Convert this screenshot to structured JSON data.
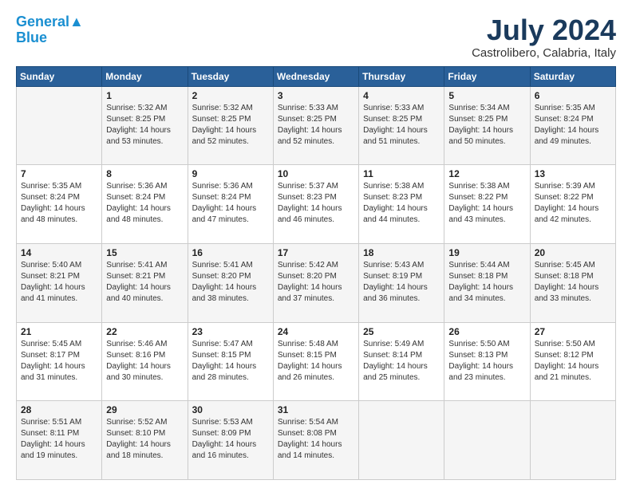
{
  "header": {
    "logo_line1": "General",
    "logo_line2": "Blue",
    "main_title": "July 2024",
    "subtitle": "Castrolibero, Calabria, Italy"
  },
  "calendar": {
    "days_of_week": [
      "Sunday",
      "Monday",
      "Tuesday",
      "Wednesday",
      "Thursday",
      "Friday",
      "Saturday"
    ],
    "weeks": [
      [
        {
          "day": "",
          "info": ""
        },
        {
          "day": "1",
          "info": "Sunrise: 5:32 AM\nSunset: 8:25 PM\nDaylight: 14 hours\nand 53 minutes."
        },
        {
          "day": "2",
          "info": "Sunrise: 5:32 AM\nSunset: 8:25 PM\nDaylight: 14 hours\nand 52 minutes."
        },
        {
          "day": "3",
          "info": "Sunrise: 5:33 AM\nSunset: 8:25 PM\nDaylight: 14 hours\nand 52 minutes."
        },
        {
          "day": "4",
          "info": "Sunrise: 5:33 AM\nSunset: 8:25 PM\nDaylight: 14 hours\nand 51 minutes."
        },
        {
          "day": "5",
          "info": "Sunrise: 5:34 AM\nSunset: 8:25 PM\nDaylight: 14 hours\nand 50 minutes."
        },
        {
          "day": "6",
          "info": "Sunrise: 5:35 AM\nSunset: 8:24 PM\nDaylight: 14 hours\nand 49 minutes."
        }
      ],
      [
        {
          "day": "7",
          "info": "Sunrise: 5:35 AM\nSunset: 8:24 PM\nDaylight: 14 hours\nand 48 minutes."
        },
        {
          "day": "8",
          "info": "Sunrise: 5:36 AM\nSunset: 8:24 PM\nDaylight: 14 hours\nand 48 minutes."
        },
        {
          "day": "9",
          "info": "Sunrise: 5:36 AM\nSunset: 8:24 PM\nDaylight: 14 hours\nand 47 minutes."
        },
        {
          "day": "10",
          "info": "Sunrise: 5:37 AM\nSunset: 8:23 PM\nDaylight: 14 hours\nand 46 minutes."
        },
        {
          "day": "11",
          "info": "Sunrise: 5:38 AM\nSunset: 8:23 PM\nDaylight: 14 hours\nand 44 minutes."
        },
        {
          "day": "12",
          "info": "Sunrise: 5:38 AM\nSunset: 8:22 PM\nDaylight: 14 hours\nand 43 minutes."
        },
        {
          "day": "13",
          "info": "Sunrise: 5:39 AM\nSunset: 8:22 PM\nDaylight: 14 hours\nand 42 minutes."
        }
      ],
      [
        {
          "day": "14",
          "info": "Sunrise: 5:40 AM\nSunset: 8:21 PM\nDaylight: 14 hours\nand 41 minutes."
        },
        {
          "day": "15",
          "info": "Sunrise: 5:41 AM\nSunset: 8:21 PM\nDaylight: 14 hours\nand 40 minutes."
        },
        {
          "day": "16",
          "info": "Sunrise: 5:41 AM\nSunset: 8:20 PM\nDaylight: 14 hours\nand 38 minutes."
        },
        {
          "day": "17",
          "info": "Sunrise: 5:42 AM\nSunset: 8:20 PM\nDaylight: 14 hours\nand 37 minutes."
        },
        {
          "day": "18",
          "info": "Sunrise: 5:43 AM\nSunset: 8:19 PM\nDaylight: 14 hours\nand 36 minutes."
        },
        {
          "day": "19",
          "info": "Sunrise: 5:44 AM\nSunset: 8:18 PM\nDaylight: 14 hours\nand 34 minutes."
        },
        {
          "day": "20",
          "info": "Sunrise: 5:45 AM\nSunset: 8:18 PM\nDaylight: 14 hours\nand 33 minutes."
        }
      ],
      [
        {
          "day": "21",
          "info": "Sunrise: 5:45 AM\nSunset: 8:17 PM\nDaylight: 14 hours\nand 31 minutes."
        },
        {
          "day": "22",
          "info": "Sunrise: 5:46 AM\nSunset: 8:16 PM\nDaylight: 14 hours\nand 30 minutes."
        },
        {
          "day": "23",
          "info": "Sunrise: 5:47 AM\nSunset: 8:15 PM\nDaylight: 14 hours\nand 28 minutes."
        },
        {
          "day": "24",
          "info": "Sunrise: 5:48 AM\nSunset: 8:15 PM\nDaylight: 14 hours\nand 26 minutes."
        },
        {
          "day": "25",
          "info": "Sunrise: 5:49 AM\nSunset: 8:14 PM\nDaylight: 14 hours\nand 25 minutes."
        },
        {
          "day": "26",
          "info": "Sunrise: 5:50 AM\nSunset: 8:13 PM\nDaylight: 14 hours\nand 23 minutes."
        },
        {
          "day": "27",
          "info": "Sunrise: 5:50 AM\nSunset: 8:12 PM\nDaylight: 14 hours\nand 21 minutes."
        }
      ],
      [
        {
          "day": "28",
          "info": "Sunrise: 5:51 AM\nSunset: 8:11 PM\nDaylight: 14 hours\nand 19 minutes."
        },
        {
          "day": "29",
          "info": "Sunrise: 5:52 AM\nSunset: 8:10 PM\nDaylight: 14 hours\nand 18 minutes."
        },
        {
          "day": "30",
          "info": "Sunrise: 5:53 AM\nSunset: 8:09 PM\nDaylight: 14 hours\nand 16 minutes."
        },
        {
          "day": "31",
          "info": "Sunrise: 5:54 AM\nSunset: 8:08 PM\nDaylight: 14 hours\nand 14 minutes."
        },
        {
          "day": "",
          "info": ""
        },
        {
          "day": "",
          "info": ""
        },
        {
          "day": "",
          "info": ""
        }
      ]
    ]
  }
}
